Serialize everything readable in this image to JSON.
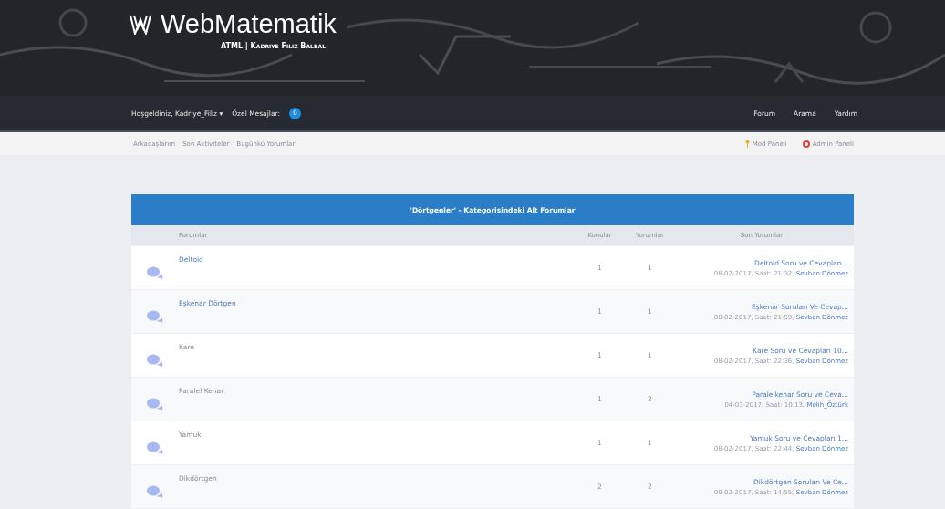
{
  "site": {
    "title": "WebMatematik",
    "subtitle": "ATML | Kadriye Filiz Balbal"
  },
  "user_bar": {
    "welcome": "Hoşgeldiniz, Kadriye_Filiz",
    "caret": "▾",
    "messages_label": "Özel Mesajlar:",
    "messages_count": "0",
    "links": [
      "Forum",
      "Arama",
      "Yardım"
    ]
  },
  "sub_nav": {
    "links": [
      "Arkadaşlarım",
      "Son Aktiviteler",
      "Bugünkü Yorumlar"
    ],
    "mod_panel": "Mod Paneli",
    "admin_panel": "Admin Paneli"
  },
  "table": {
    "title": "'Dörtgenler' - Kategorisindeki Alt Forumlar",
    "columns": [
      "Forumlar",
      "Konular",
      "Yorumlar",
      "Son Yorumlar"
    ],
    "rows": [
      {
        "name": "Deltoid",
        "unread": true,
        "topics": "1",
        "posts": "1",
        "last_title": "Deltoid Soru ve Cevapları...",
        "last_date": "08-02-2017, Saat: 21:32,",
        "last_user": "Sevban Dönmez"
      },
      {
        "name": "Eşkenar Dörtgen",
        "unread": true,
        "topics": "1",
        "posts": "1",
        "last_title": "Eşkenar Soruları Ve Cevap...",
        "last_date": "08-02-2017, Saat: 21:59,",
        "last_user": "Sevban Dönmez"
      },
      {
        "name": "Kare",
        "unread": false,
        "topics": "1",
        "posts": "1",
        "last_title": "Kare Soru ve Cevapları 10...",
        "last_date": "08-02-2017, Saat: 22:36,",
        "last_user": "Sevban Dönmez"
      },
      {
        "name": "Paralel Kenar",
        "unread": false,
        "topics": "1",
        "posts": "2",
        "last_title": "Paralelkenar Soru ve Ceva...",
        "last_date": "04-03-2017, Saat: 10:13,",
        "last_user": "Melih_Öztürk"
      },
      {
        "name": "Yamuk",
        "unread": false,
        "topics": "1",
        "posts": "1",
        "last_title": "Yamuk Soru ve Cevapları 1...",
        "last_date": "08-02-2017, Saat: 22:44,",
        "last_user": "Sevban Dönmez"
      },
      {
        "name": "Dikdörtgen",
        "unread": false,
        "topics": "2",
        "posts": "2",
        "last_title": "Dikdörtgen Soruları Ve Ce...",
        "last_date": "09-02-2017, Saat: 14:55,",
        "last_user": "Sevban Dönmez"
      }
    ]
  }
}
